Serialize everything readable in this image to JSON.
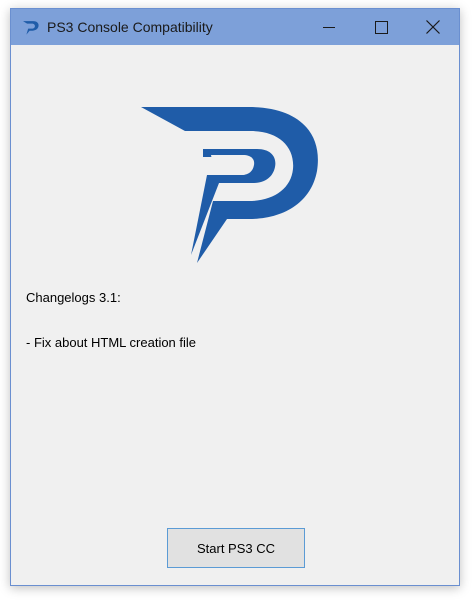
{
  "window": {
    "title": "PS3 Console Compatibility",
    "app_icon": "ps3cc-logo-icon",
    "caption": {
      "minimize_icon": "minimize-icon",
      "maximize_icon": "maximize-icon",
      "close_icon": "close-icon"
    }
  },
  "main": {
    "logo": "ps3cc-logo",
    "changelog_title": "Changelogs 3.1:",
    "changelog_items": [
      "- Fix about HTML creation file"
    ],
    "start_button_label": "Start PS3 CC"
  },
  "colors": {
    "titlebar": "#7da0d9",
    "logo_blue": "#1f5ca8",
    "window_bg": "#f0f0f0",
    "button_border": "#5b9bd5"
  }
}
